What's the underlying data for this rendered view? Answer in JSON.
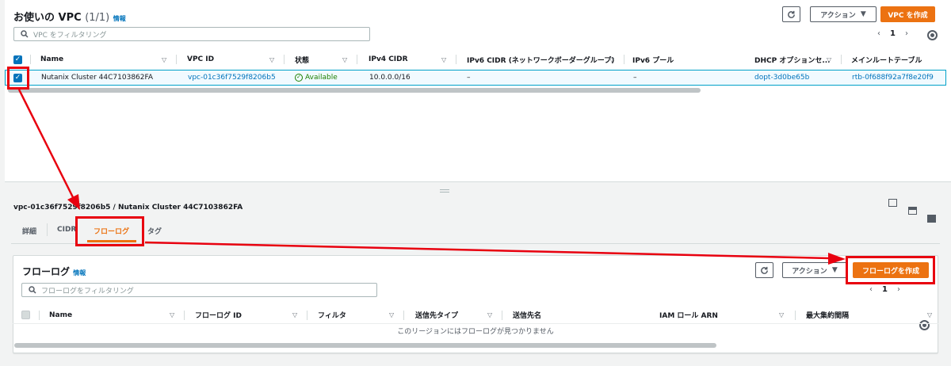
{
  "vpc_list": {
    "title": "お使いの VPC",
    "count": "(1/1)",
    "info": "情報",
    "refresh_icon": "refresh-icon",
    "actions_label": "アクション",
    "create_label": "VPC を作成",
    "search_placeholder": "VPC をフィルタリング",
    "page": "1",
    "columns": [
      "Name",
      "VPC ID",
      "状態",
      "IPv4 CIDR",
      "IPv6 CIDR (ネットワークボーダーグループ)",
      "IPv6 プール",
      "DHCP オプションセ...",
      "メインルートテーブル"
    ],
    "row": {
      "name": "Nutanix Cluster 44C7103862FA",
      "vpc_id": "vpc-01c36f7529f8206b5",
      "state": "Available",
      "ipv4": "10.0.0.0/16",
      "ipv6": "–",
      "ipv6_pool": "–",
      "dhcp": "dopt-3d0be65b",
      "route_table": "rtb-0f688f92a7f8e20f9"
    }
  },
  "detail": {
    "heading": "vpc-01c36f7529f8206b5 / Nutanix Cluster 44C7103862FA",
    "tabs": [
      "詳細",
      "CIDR",
      "フローログ",
      "タグ"
    ],
    "active_tab": "フローログ"
  },
  "flowlogs": {
    "title": "フローログ",
    "info": "情報",
    "actions_label": "アクション",
    "create_label": "フローログを作成",
    "search_placeholder": "フローログをフィルタリング",
    "page": "1",
    "columns": [
      "Name",
      "フローログ ID",
      "フィルタ",
      "送信先タイプ",
      "送信先名",
      "IAM ロール ARN",
      "最大集約間隔"
    ],
    "empty": "このリージョンにはフローログが見つかりません"
  },
  "colors": {
    "accent": "#ec7211",
    "link": "#0073bb",
    "success": "#1d8102",
    "annotation": "#e8000f"
  }
}
